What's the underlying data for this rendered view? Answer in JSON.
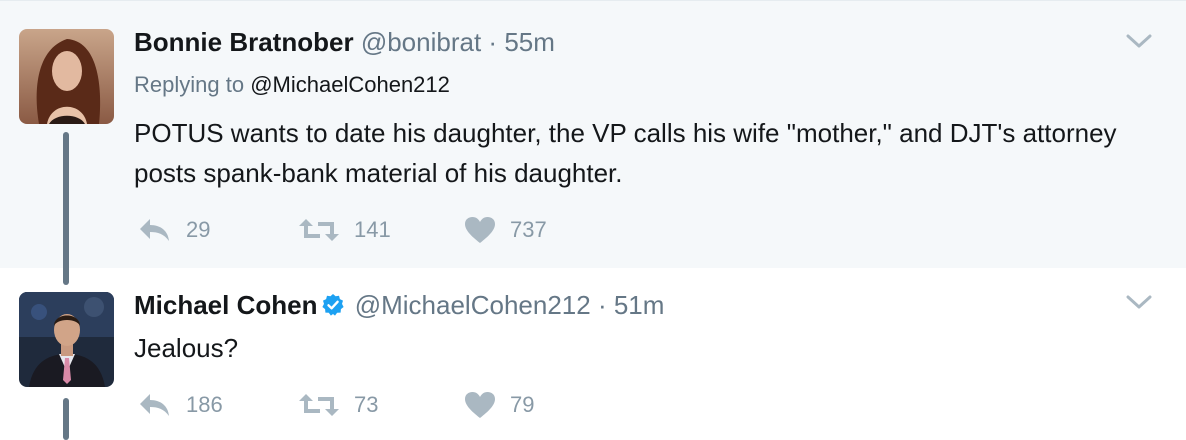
{
  "tweets": [
    {
      "name": "Bonnie Bratnober",
      "handle": "@bonibrat",
      "separator": "·",
      "time": "55m",
      "replying_label": "Replying to",
      "replying_to": "@MichaelCohen212",
      "text": "POTUS wants to date his daughter, the VP calls his wife \"mother,\" and DJT's attorney posts spank-bank material of his daughter.",
      "replies": "29",
      "retweets": "141",
      "likes": "737"
    },
    {
      "name": "Michael Cohen",
      "handle": "@MichaelCohen212",
      "separator": "·",
      "time": "51m",
      "verified": true,
      "text": "Jealous?",
      "replies": "186",
      "retweets": "73",
      "likes": "79"
    }
  ],
  "colors": {
    "background_highlight": "#f5f8fa",
    "secondary_text": "#657786",
    "action_icon": "#aab8c2",
    "verified": "#1da1f2",
    "thread_line": "#657786"
  }
}
